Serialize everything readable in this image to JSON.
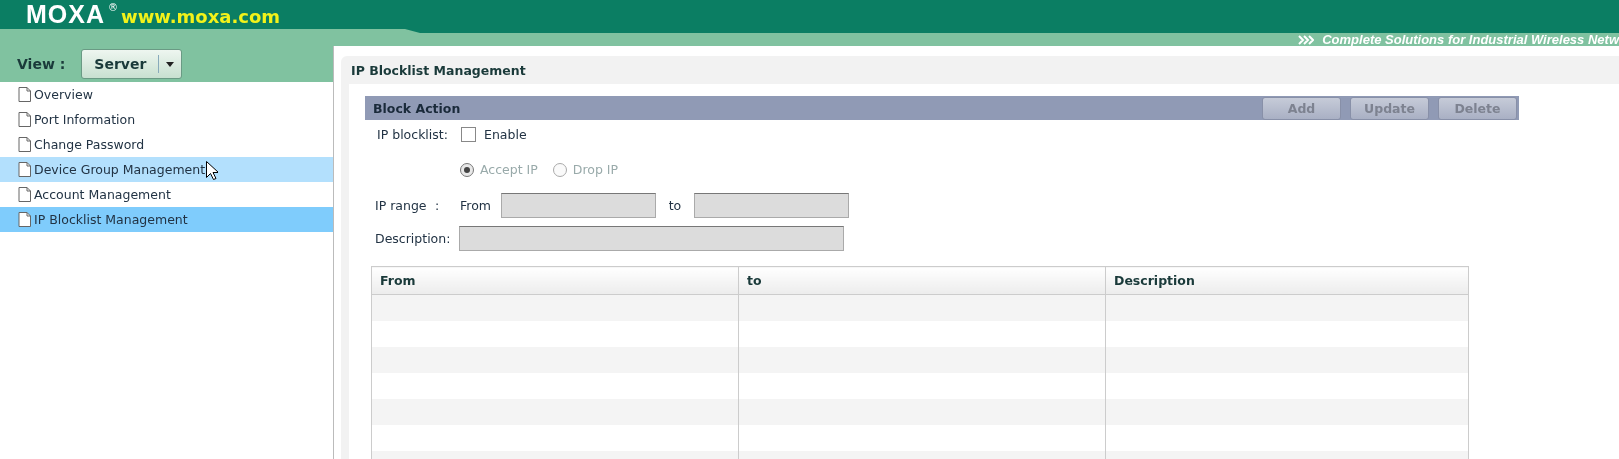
{
  "header": {
    "logo": "MOXA",
    "registered": "®",
    "url": "www.moxa.com",
    "tagline": "Complete Solutions for Industrial Wireless Netw"
  },
  "sidebar": {
    "view_label": "View :",
    "view_value": "Server",
    "items": [
      {
        "label": "Overview",
        "selected": false,
        "hovered": false
      },
      {
        "label": "Port Information",
        "selected": false,
        "hovered": false
      },
      {
        "label": "Change Password",
        "selected": false,
        "hovered": false
      },
      {
        "label": "Device Group Management",
        "selected": false,
        "hovered": true
      },
      {
        "label": "Account Management",
        "selected": false,
        "hovered": false
      },
      {
        "label": "IP Blocklist Management",
        "selected": true,
        "hovered": false
      }
    ]
  },
  "panel": {
    "title": "IP Blocklist Management",
    "section": "Block Action",
    "buttons": [
      {
        "label": "Add",
        "disabled": true
      },
      {
        "label": "Update",
        "disabled": true
      },
      {
        "label": "Delete",
        "disabled": true
      }
    ],
    "blocklist_label": "IP blocklist:",
    "enable": {
      "label": "Enable",
      "checked": false
    },
    "radios": [
      {
        "label": "Accept IP",
        "selected": true,
        "disabled": true
      },
      {
        "label": "Drop IP",
        "selected": false,
        "disabled": true
      }
    ],
    "range_label": "IP range",
    "range_colon": ":",
    "from_label": "From",
    "to_label": "to",
    "description_label": "Description:",
    "table": {
      "columns": [
        "From",
        "to",
        "Description"
      ]
    }
  }
}
